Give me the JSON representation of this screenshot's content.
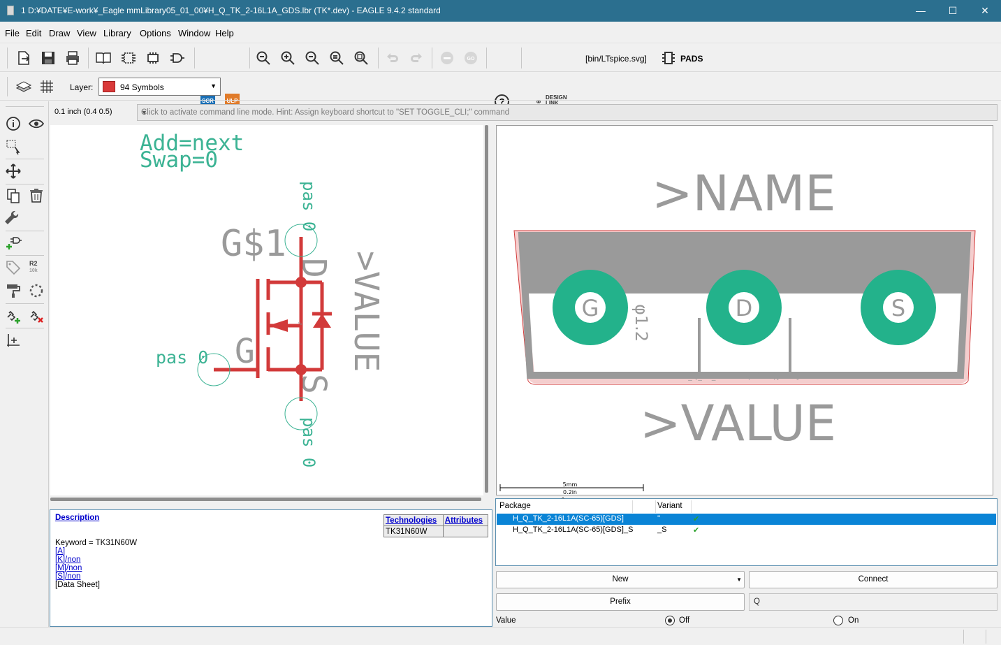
{
  "window": {
    "title": "1 D:¥DATE¥E-work¥_Eagle mmLibrary05_01_00¥H_Q_TK_2-16L1A_GDS.lbr (TK*.dev) - EAGLE 9.4.2 standard",
    "minimize": "—",
    "maximize": "☐",
    "close": "✕"
  },
  "menu": [
    "File",
    "Edit",
    "Draw",
    "View",
    "Library",
    "Options",
    "Window",
    "Help"
  ],
  "toolbar": {
    "scr": "SCR",
    "ulp": "ULP",
    "help": "?",
    "design_link": "DESIGN\nLINK",
    "design_link_top": "DESIGN",
    "design_link_bottom": "LINK",
    "script_path": "[bin/LTspice.svg]",
    "pads": "PADS"
  },
  "layer": {
    "label": "Layer:",
    "selected": "94 Symbols",
    "color": "#d93a3a"
  },
  "coordinates": "0.1 inch (0.4 0.5)",
  "command_line": {
    "hint": "Click to activate command line mode. Hint: Assign keyboard shortcut to \"SET TOGGLE_CLI;\" command"
  },
  "symbol": {
    "add": "Add=next",
    "swap": "Swap=0",
    "gate": "G$1",
    "value": ">VALUE",
    "pin_top": "pas 0",
    "pin_left": "pas 0",
    "pin_bottom": "pas 0",
    "label_d": "D",
    "label_g": "G",
    "label_s": "S"
  },
  "package": {
    "name": ">NAME",
    "value": ">VALUE",
    "pad_g": "G",
    "pad_d": "D",
    "pad_s": "S",
    "drill": "φ1.2",
    "pkg_label": "H_Q_TK_2-16L1A(SC-65)[GDS]",
    "scale_mm": "5mm",
    "scale_in": "0.2in"
  },
  "description": {
    "title": "Description",
    "keyword": "Keyword = TK31N60W",
    "lines": [
      "[A]",
      "[K]/non",
      "[M]/non",
      "[S]/non"
    ],
    "datasheet": "[Data Sheet]",
    "technologies_header": "Technologies",
    "attributes_header": "Attributes",
    "technology": "TK31N60W"
  },
  "variants": {
    "col_package": "Package",
    "col_variant": "Variant",
    "rows": [
      {
        "package": "H_Q_TK_2-16L1A(SC-65)[GDS]",
        "variant": "''",
        "check": "✔"
      },
      {
        "package": "H_Q_TK_2-16L1A(SC-65)[GDS]_S",
        "variant": "_S",
        "check": "✔"
      }
    ]
  },
  "buttons": {
    "new": "New",
    "connect": "Connect",
    "prefix": "Prefix",
    "prefix_value": "Q",
    "value_label": "Value",
    "off": "Off",
    "on": "On"
  },
  "colors": {
    "title_bar": "#2b6f8f",
    "symbol_red": "#d23a3a",
    "text_green": "#3cb394",
    "pad_green": "#23b28b",
    "selection_blue": "#0a84d6"
  }
}
